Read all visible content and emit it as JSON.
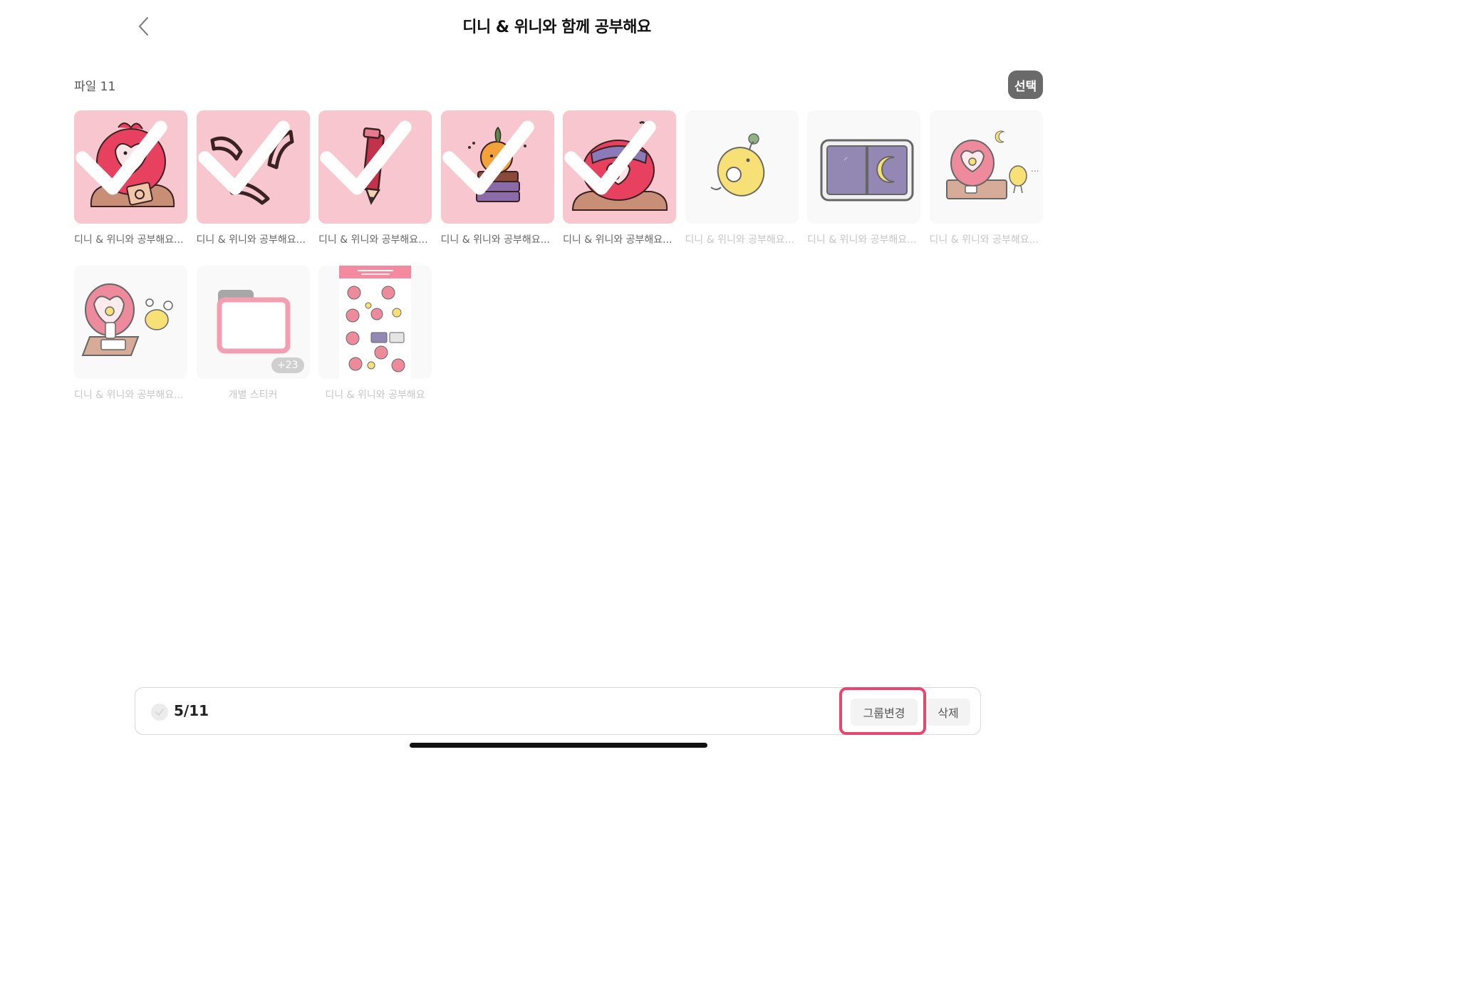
{
  "header": {
    "title": "디니 & 위니와 함께 공부해요"
  },
  "subbar": {
    "file_count": "파일 11",
    "select_label": "선택"
  },
  "items": [
    {
      "caption": "디니 & 위니와 공부해요...",
      "selected": true,
      "art": "red-bird-desk"
    },
    {
      "caption": "디니 & 위니와 공부해요...",
      "selected": true,
      "art": "eyebrows"
    },
    {
      "caption": "디니 & 위니와 공부해요...",
      "selected": true,
      "art": "pencil"
    },
    {
      "caption": "디니 & 위니와 공부해요...",
      "selected": true,
      "art": "bird-on-books"
    },
    {
      "caption": "디니 & 위니와 공부해요...",
      "selected": true,
      "art": "bird-headband"
    },
    {
      "caption": "디니 & 위니와 공부해요...",
      "selected": false,
      "art": "yellow-bird"
    },
    {
      "caption": "디니 & 위니와 공부해요...",
      "selected": false,
      "art": "night-window"
    },
    {
      "caption": "디니 & 위니와 공부해요...",
      "selected": false,
      "art": "two-birds-desk"
    },
    {
      "caption": "디니 & 위니와 공부해요...",
      "selected": false,
      "art": "red-bird-phone"
    },
    {
      "caption": "개별 스티커",
      "selected": false,
      "art": "folder",
      "badge": "+23"
    },
    {
      "caption": "디니 & 위니와 공부해요",
      "selected": false,
      "art": "sticker-sheet"
    }
  ],
  "bottom": {
    "count": "5/11",
    "group_change_label": "그룹변경",
    "delete_label": "삭제"
  },
  "colors": {
    "accent": "#e8456f",
    "selected_bg": "#f8c6ce",
    "bird_red": "#e8415f",
    "bird_yellow": "#f5d84a"
  }
}
